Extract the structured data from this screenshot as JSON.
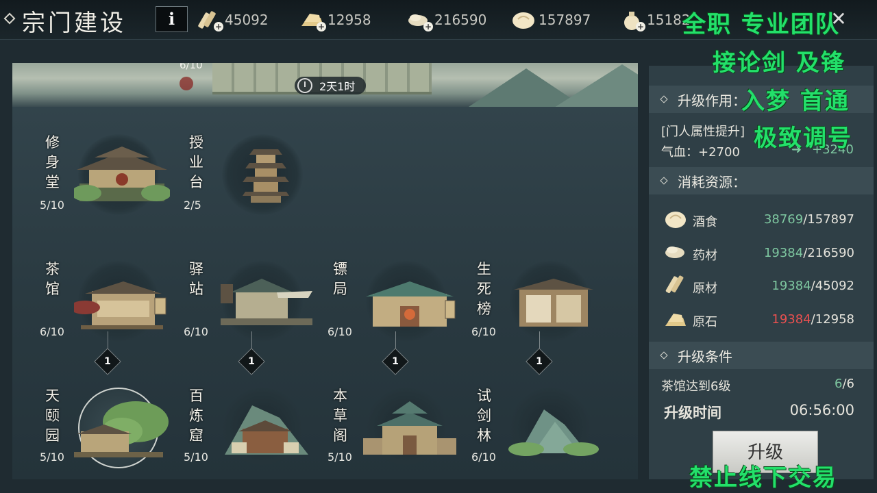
{
  "header": {
    "title": "宗门建设",
    "info_label": "i",
    "resources": [
      {
        "name": "原材",
        "icon": "wood-plank-icon",
        "value": "45092"
      },
      {
        "name": "原石",
        "icon": "stone-ingot-icon",
        "value": "12958"
      },
      {
        "name": "药材",
        "icon": "herb-bundle-icon",
        "value": "216590"
      },
      {
        "name": "酒食",
        "icon": "steamed-bun-icon",
        "value": "157897"
      },
      {
        "name": "silver",
        "icon": "money-bag-icon",
        "value": "15182"
      }
    ],
    "close_label": "✕"
  },
  "banner": {
    "level": "6/10",
    "timer": "2天1时"
  },
  "buildings": {
    "xiushentang": {
      "name": "修身堂",
      "level": "5/10"
    },
    "shouyetai": {
      "name": "授业台",
      "level": "2/5"
    },
    "chaguan": {
      "name": "茶馆",
      "level": "6/10"
    },
    "yizhan": {
      "name": "驿站",
      "level": "6/10"
    },
    "biaoju": {
      "name": "镖局",
      "level": "6/10"
    },
    "shengsibang": {
      "name": "生死榜",
      "level": "6/10"
    },
    "tianyiyuan": {
      "name": "天颐园",
      "level": "5/10"
    },
    "bailianku": {
      "name": "百炼窟",
      "level": "5/10"
    },
    "bencaoge": {
      "name": "本草阁",
      "level": "5/10"
    },
    "shijianlin": {
      "name": "试剑林",
      "level": "6/10"
    }
  },
  "nodes": [
    "1",
    "1",
    "1",
    "1"
  ],
  "side": {
    "effect_title": "升级作用：",
    "effect_desc": "[门人属性提升]",
    "effect_stat_label": "气血：+2700",
    "effect_stat_next": "+3240",
    "cost_title": "消耗资源：",
    "costs": [
      {
        "name": "酒食",
        "icon": "steamed-bun-icon",
        "need": "38769",
        "have": "/157897",
        "status_color": "#7ec7a0"
      },
      {
        "name": "药材",
        "icon": "herb-bundle-icon",
        "need": "19384",
        "have": "/216590",
        "status_color": "#7ec7a0"
      },
      {
        "name": "原材",
        "icon": "wood-plank-icon",
        "need": "19384",
        "have": "/45092",
        "status_color": "#7ec7a0"
      },
      {
        "name": "原石",
        "icon": "stone-ingot-icon",
        "need": "19384",
        "have": "/12958",
        "status_color": "#ea5050"
      }
    ],
    "cond_title": "升级条件",
    "cond_text": "茶馆达到6级",
    "cond_cur": "6",
    "cond_max": "/6",
    "time_label": "升级时间",
    "time_value": "06:56:00",
    "upgrade_label": "升级"
  },
  "watermark": {
    "line1": "全职 专业团队",
    "line2": "接论剑 及锋",
    "line3": "入梦 首通",
    "line4": "极致调号",
    "line5": "禁止线下交易"
  }
}
